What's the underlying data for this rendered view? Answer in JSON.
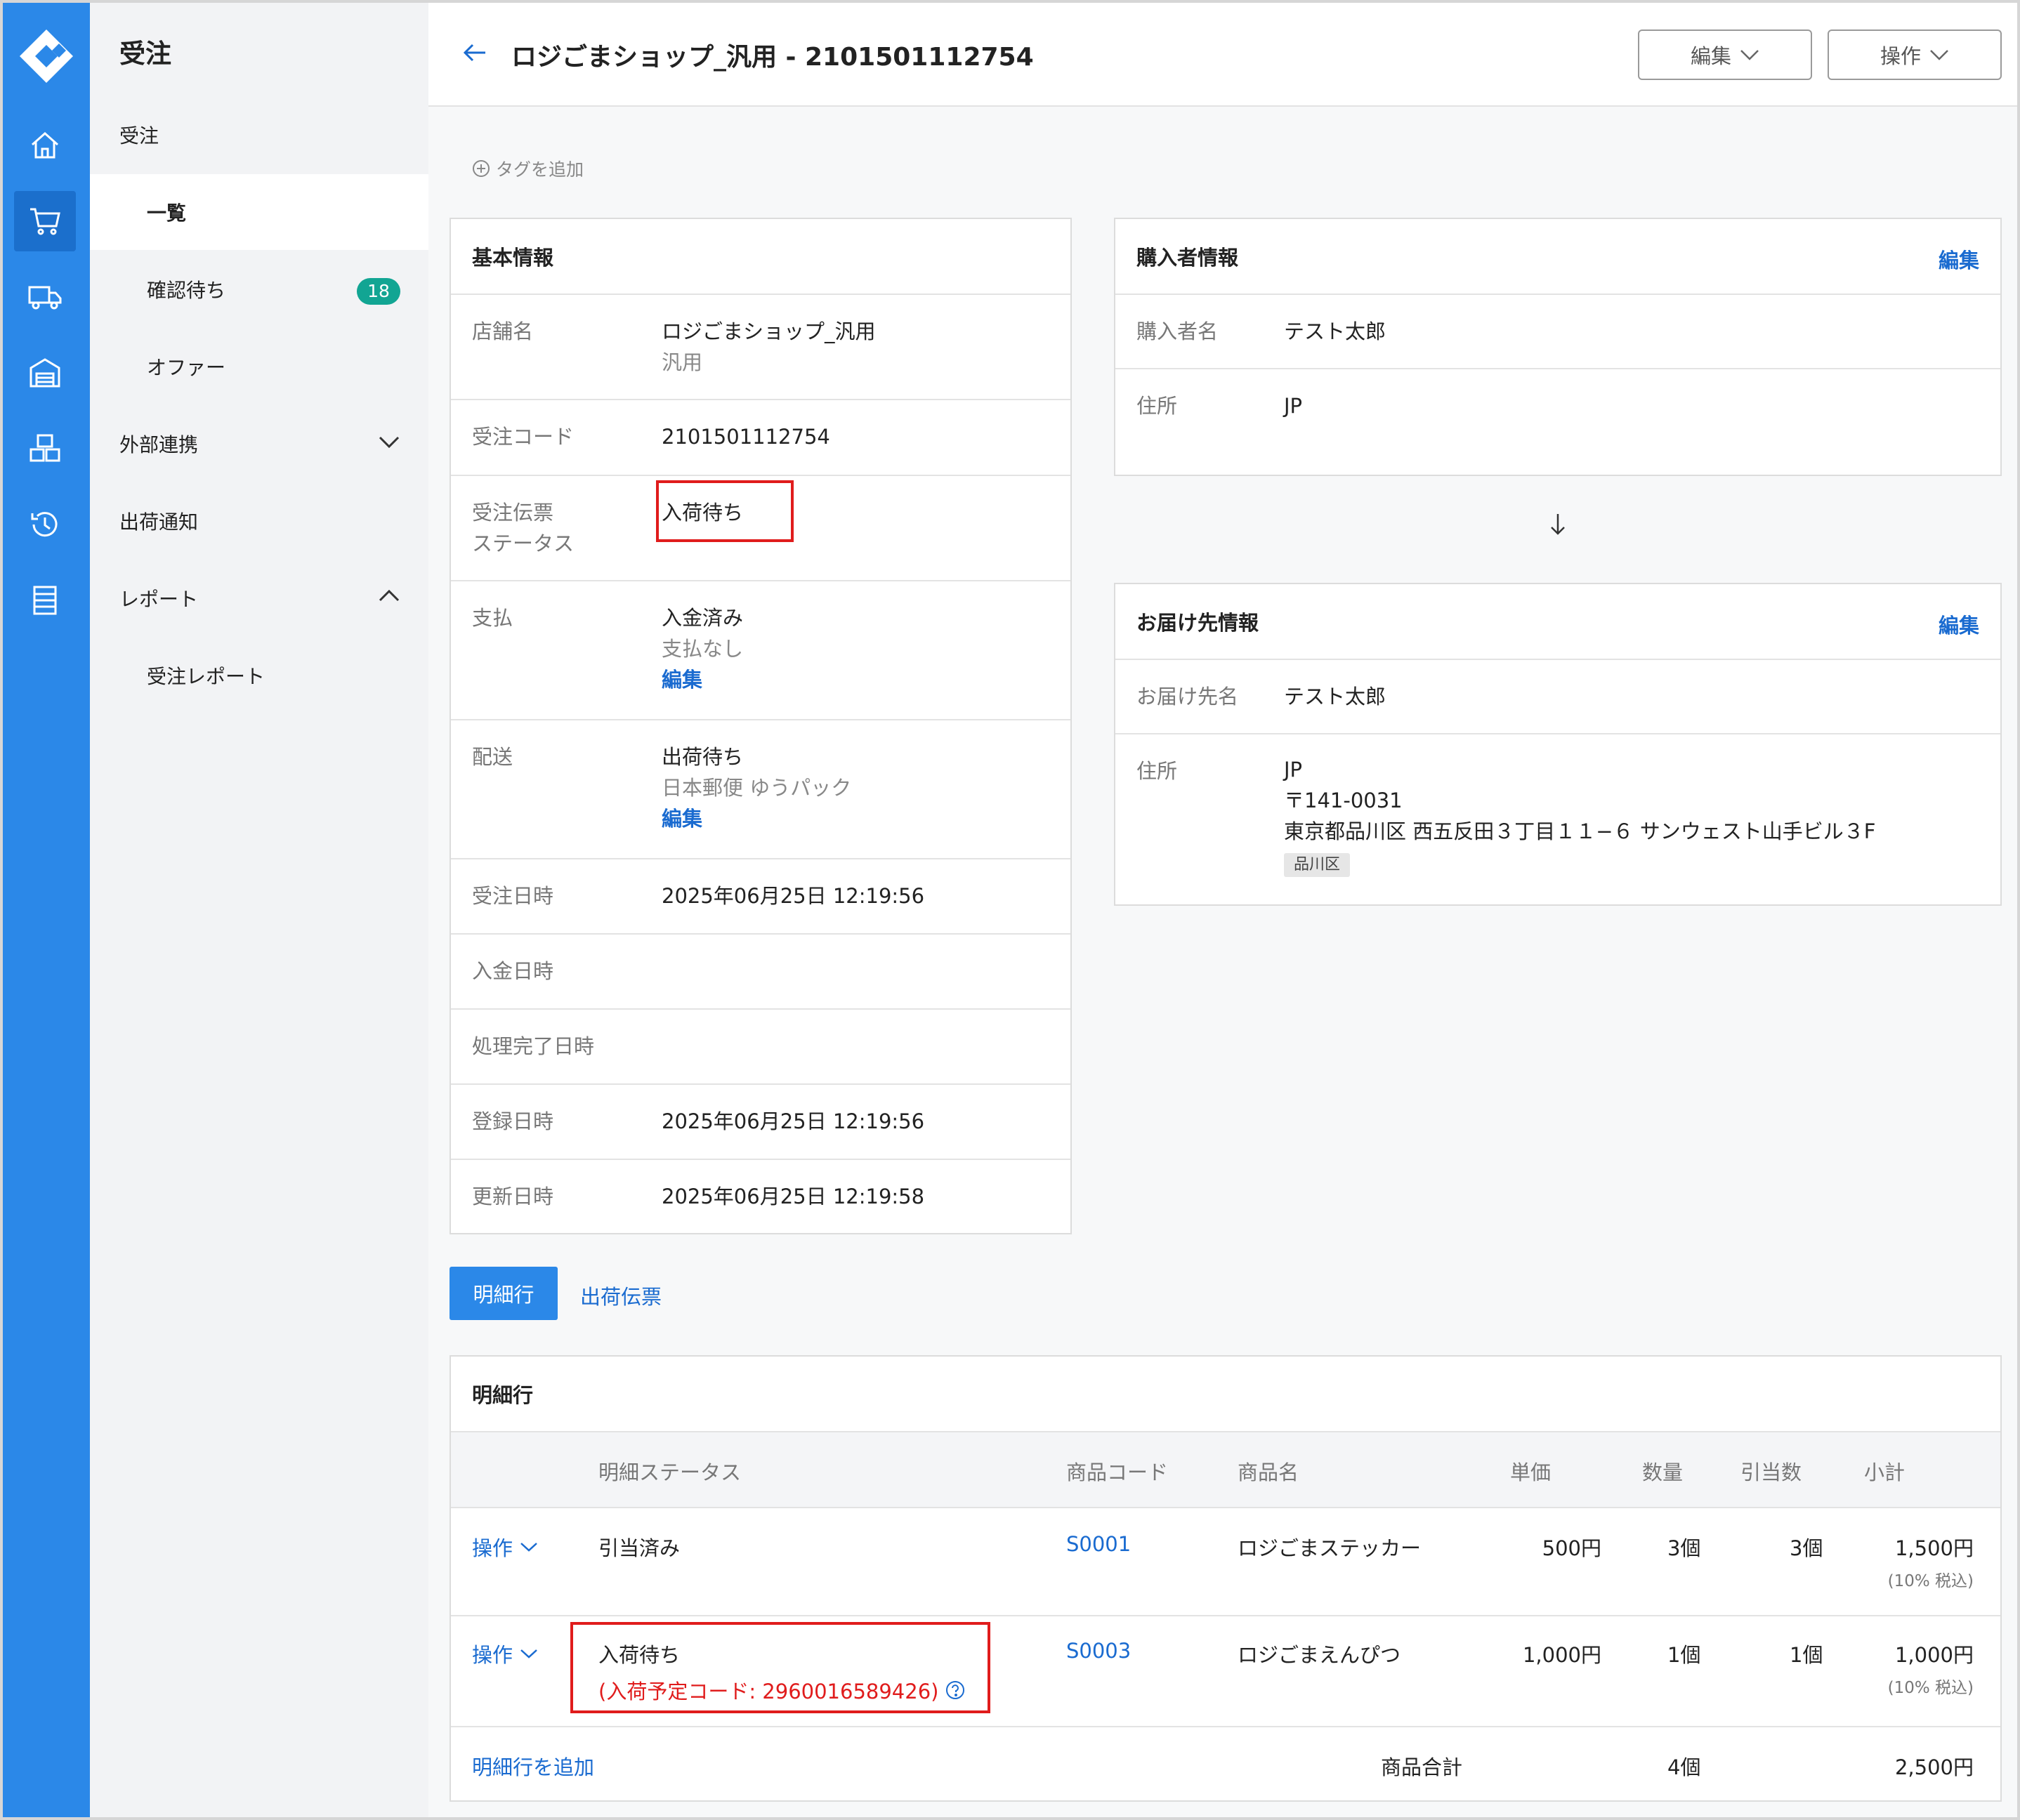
{
  "colors": {
    "primary": "#2b88e8",
    "link": "#1a6bd0",
    "badge": "#12a593",
    "alert": "#e01c1c"
  },
  "rail": {
    "icons": [
      "logo-icon",
      "home-icon",
      "cart-icon",
      "truck-icon",
      "warehouse-icon",
      "boxes-icon",
      "history-icon",
      "report-icon"
    ]
  },
  "sidebar": {
    "title": "受注",
    "items": [
      {
        "label": "受注"
      },
      {
        "label": "一覧"
      },
      {
        "label": "確認待ち",
        "badge": "18"
      },
      {
        "label": "オファー"
      },
      {
        "label": "外部連携"
      },
      {
        "label": "出荷通知"
      },
      {
        "label": "レポート"
      },
      {
        "label": "受注レポート"
      }
    ]
  },
  "header": {
    "title": "ロジごまショップ_汎用 - 2101501112754",
    "edit_label": "編集",
    "operate_label": "操作"
  },
  "tag_add": "タグを追加",
  "basic": {
    "title": "基本情報",
    "shop_label": "店舗名",
    "shop_value": "ロジごまショップ_汎用",
    "shop_sub": "汎用",
    "code_label": "受注コード",
    "code_value": "2101501112754",
    "status_label_1": "受注伝票",
    "status_label_2": "ステータス",
    "status_value": "入荷待ち",
    "payment_label": "支払",
    "payment_value": "入金済み",
    "payment_sub": "支払なし",
    "payment_edit": "編集",
    "delivery_label": "配送",
    "delivery_value": "出荷待ち",
    "delivery_sub": "日本郵便 ゆうパック",
    "delivery_edit": "編集",
    "order_date_label": "受注日時",
    "order_date_value": "2025年06月25日 12:19:56",
    "paid_date_label": "入金日時",
    "done_date_label": "処理完了日時",
    "created_label": "登録日時",
    "created_value": "2025年06月25日 12:19:56",
    "updated_label": "更新日時",
    "updated_value": "2025年06月25日 12:19:58"
  },
  "buyer": {
    "title": "購入者情報",
    "edit": "編集",
    "name_label": "購入者名",
    "name_value": "テスト太郎",
    "addr_label": "住所",
    "addr_value": "JP"
  },
  "dest": {
    "title": "お届け先情報",
    "edit": "編集",
    "name_label": "お届け先名",
    "name_value": "テスト太郎",
    "addr_label": "住所",
    "addr_country": "JP",
    "addr_zip": "〒141-0031",
    "addr_line": "東京都品川区 西五反田３丁目１１−６ サンウェスト山手ビル３F",
    "addr_tag": "品川区"
  },
  "tabs": {
    "active": "明細行",
    "other": "出荷伝票"
  },
  "lines": {
    "title": "明細行",
    "headers": {
      "status": "明細ステータス",
      "code": "商品コード",
      "name": "商品名",
      "price": "単価",
      "qty": "数量",
      "alloc": "引当数",
      "subtotal": "小計"
    },
    "rows": [
      {
        "op": "操作",
        "status": "引当済み",
        "code": "S0001",
        "name": "ロジごまステッカー",
        "price": "500円",
        "qty": "3個",
        "alloc": "3個",
        "subtotal": "1,500円",
        "tax": "(10% 税込)"
      },
      {
        "op": "操作",
        "status": "入荷待ち",
        "status_note": "(入荷予定コード: 2960016589426)",
        "code": "S0003",
        "name": "ロジごまえんぴつ",
        "price": "1,000円",
        "qty": "1個",
        "alloc": "1個",
        "subtotal": "1,000円",
        "tax": "(10% 税込)"
      }
    ],
    "add_line": "明細行を追加",
    "total_label": "商品合計",
    "total_qty": "4個",
    "total_amount": "2,500円"
  }
}
